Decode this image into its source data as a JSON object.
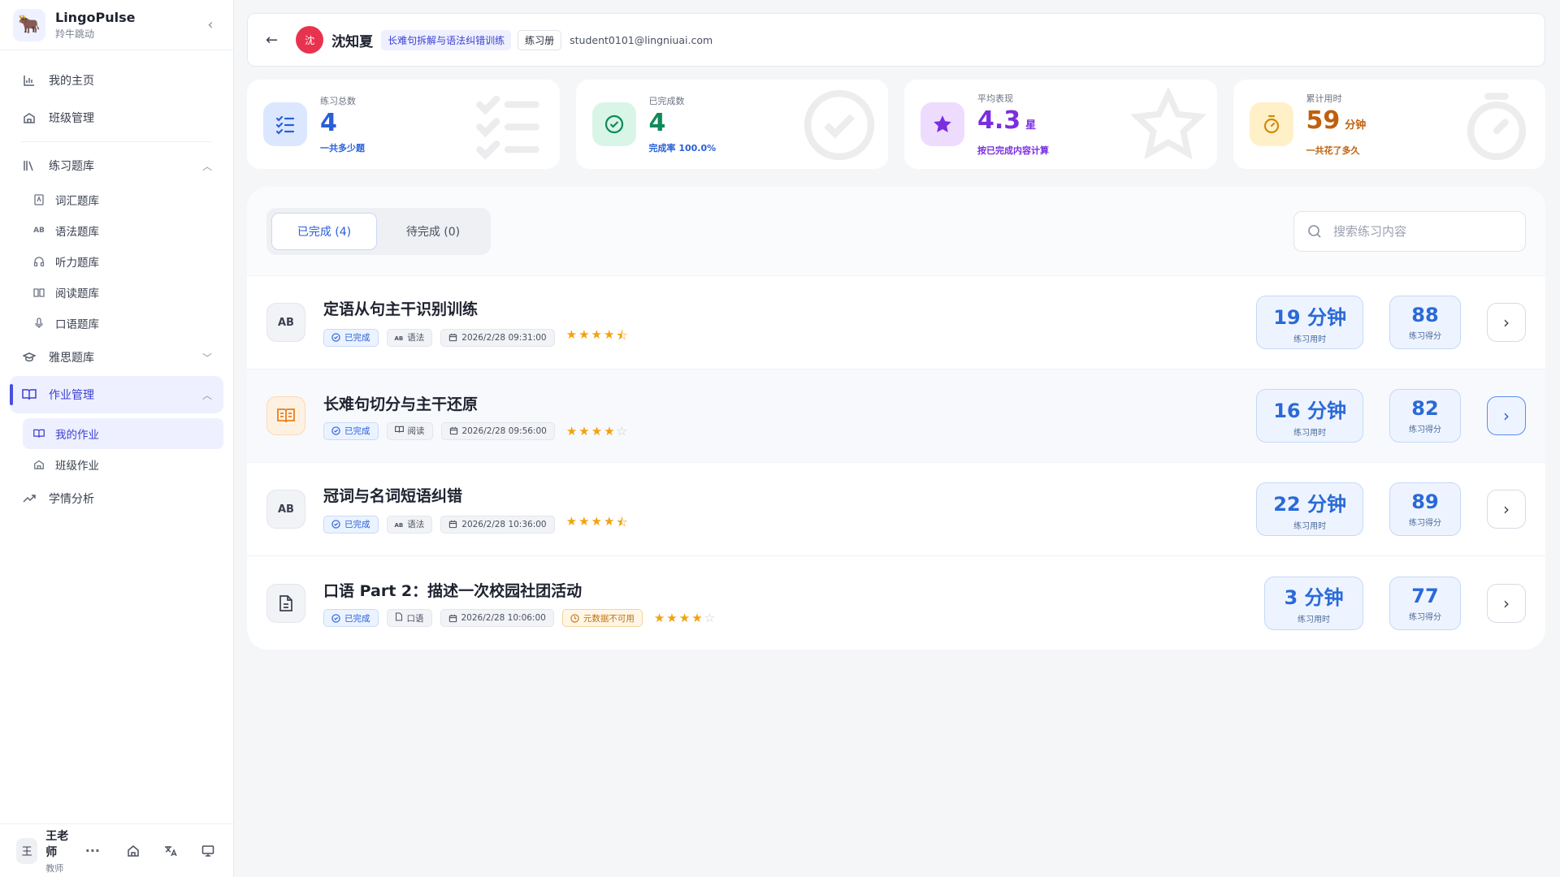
{
  "brand": {
    "name": "LingoPulse",
    "subtitle": "羚牛跳动"
  },
  "nav": {
    "home": "我的主页",
    "class_mgmt": "班级管理",
    "practice_bank": "练习题库",
    "vocab": "词汇题库",
    "grammar": "语法题库",
    "listening": "听力题库",
    "reading": "阅读题库",
    "speaking": "口语题库",
    "ielts": "雅思题库",
    "homework": "作业管理",
    "my_homework": "我的作业",
    "class_homework": "班级作业",
    "analytics": "学情分析"
  },
  "user": {
    "initial": "王",
    "name": "王老师",
    "role": "教师",
    "more": "···"
  },
  "header": {
    "avatar": "沈",
    "name": "沈知夏",
    "course_tag": "长难句拆解与语法纠错训练",
    "book_tag": "练习册",
    "email": "student0101@lingniuai.com"
  },
  "stats": [
    {
      "label": "练习总数",
      "value": "4",
      "unit": "",
      "sub": "一共多少题",
      "color": "#2a5fd8"
    },
    {
      "label": "已完成数",
      "value": "4",
      "unit": "",
      "sub": "完成率 100.0%",
      "color": "#0d8a5a"
    },
    {
      "label": "平均表现",
      "value": "4.3",
      "unit": "星",
      "sub": "按已完成内容计算",
      "color": "#7a2ee0"
    },
    {
      "label": "累计用时",
      "value": "59",
      "unit": "分钟",
      "sub": "一共花了多久",
      "color": "#c0600c"
    }
  ],
  "tabs": {
    "completed": "已完成 (4)",
    "pending": "待完成 (0)"
  },
  "search": {
    "placeholder": "搜索练习内容"
  },
  "rows": [
    {
      "icon": "AB",
      "title": "定语从句主干识别训练",
      "status": "已完成",
      "type_icon": "AB",
      "type": "语法",
      "date": "2026/2/28 09:31:00",
      "warn": "",
      "rating": 4.5,
      "time": "19 分钟",
      "time_label": "练习用时",
      "score": "88",
      "score_label": "练习得分"
    },
    {
      "icon": "book",
      "title": "长难句切分与主干还原",
      "status": "已完成",
      "type_icon": "book",
      "type": "阅读",
      "date": "2026/2/28 09:56:00",
      "warn": "",
      "rating": 4,
      "time": "16 分钟",
      "time_label": "练习用时",
      "score": "82",
      "score_label": "练习得分"
    },
    {
      "icon": "AB",
      "title": "冠词与名词短语纠错",
      "status": "已完成",
      "type_icon": "AB",
      "type": "语法",
      "date": "2026/2/28 10:36:00",
      "warn": "",
      "rating": 4.5,
      "time": "22 分钟",
      "time_label": "练习用时",
      "score": "89",
      "score_label": "练习得分"
    },
    {
      "icon": "doc",
      "title": "口语 Part 2：描述一次校园社团活动",
      "status": "已完成",
      "type_icon": "doc",
      "type": "口语",
      "date": "2026/2/28 10:06:00",
      "warn": "元数据不可用",
      "rating": 4,
      "time": "3 分钟",
      "time_label": "练习用时",
      "score": "77",
      "score_label": "练习得分"
    }
  ]
}
